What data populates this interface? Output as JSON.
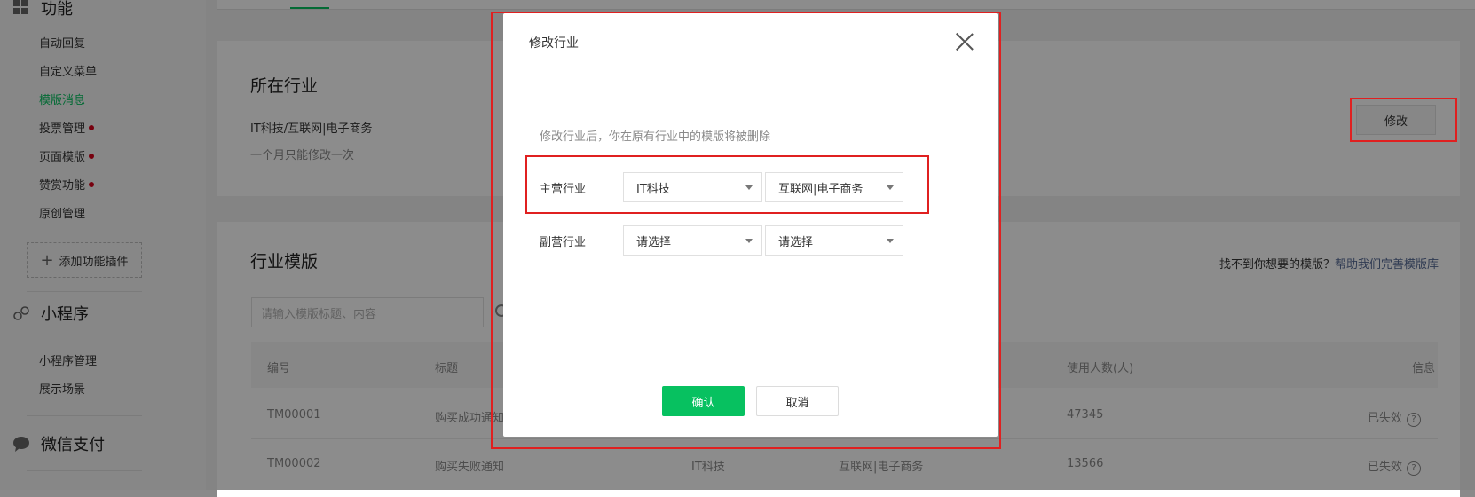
{
  "sidebar": {
    "section_function": "功能",
    "function_items": [
      {
        "label": "自动回复",
        "dot": false,
        "active": false
      },
      {
        "label": "自定义菜单",
        "dot": false,
        "active": false
      },
      {
        "label": "模版消息",
        "dot": false,
        "active": true
      },
      {
        "label": "投票管理",
        "dot": true,
        "active": false
      },
      {
        "label": "页面模版",
        "dot": true,
        "active": false
      },
      {
        "label": "赞赏功能",
        "dot": true,
        "active": false
      },
      {
        "label": "原创管理",
        "dot": false,
        "active": false
      }
    ],
    "add_plugin": "添加功能插件",
    "section_miniprogram": "小程序",
    "miniprogram_items": [
      "小程序管理",
      "展示场景"
    ],
    "section_pay": "微信支付"
  },
  "industry": {
    "title": "所在行业",
    "current": "IT科技/互联网|电子商务",
    "note": "一个月只能修改一次",
    "modify_button": "修改"
  },
  "templates": {
    "title": "行业模版",
    "search_placeholder": "请输入模版标题、内容",
    "help_text": "找不到你想要的模版？",
    "help_link": "帮助我们完善模版库",
    "columns": {
      "id": "编号",
      "title": "标题",
      "users": "使用人数(人)",
      "info": "信息"
    },
    "rows": [
      {
        "id": "TM00001",
        "title": "购买成功通知",
        "industry1": "",
        "industry2": "",
        "users": "47345",
        "status": "已失效"
      },
      {
        "id": "TM00002",
        "title": "购买失败通知",
        "industry1": "IT科技",
        "industry2": "互联网|电子商务",
        "users": "13566",
        "status": "已失效"
      }
    ],
    "help_icon_char": "?"
  },
  "dialog": {
    "title": "修改行业",
    "tip": "修改行业后，你在原有行业中的模版将被删除",
    "primary_label": "主营行业",
    "primary_value1": "IT科技",
    "primary_value2": "互联网|电子商务",
    "secondary_label": "副营行业",
    "secondary_value1": "请选择",
    "secondary_value2": "请选择",
    "confirm": "确认",
    "cancel": "取消"
  },
  "colors": {
    "accent": "#07c160",
    "highlight": "#e02020",
    "dot": "#d9001b"
  }
}
